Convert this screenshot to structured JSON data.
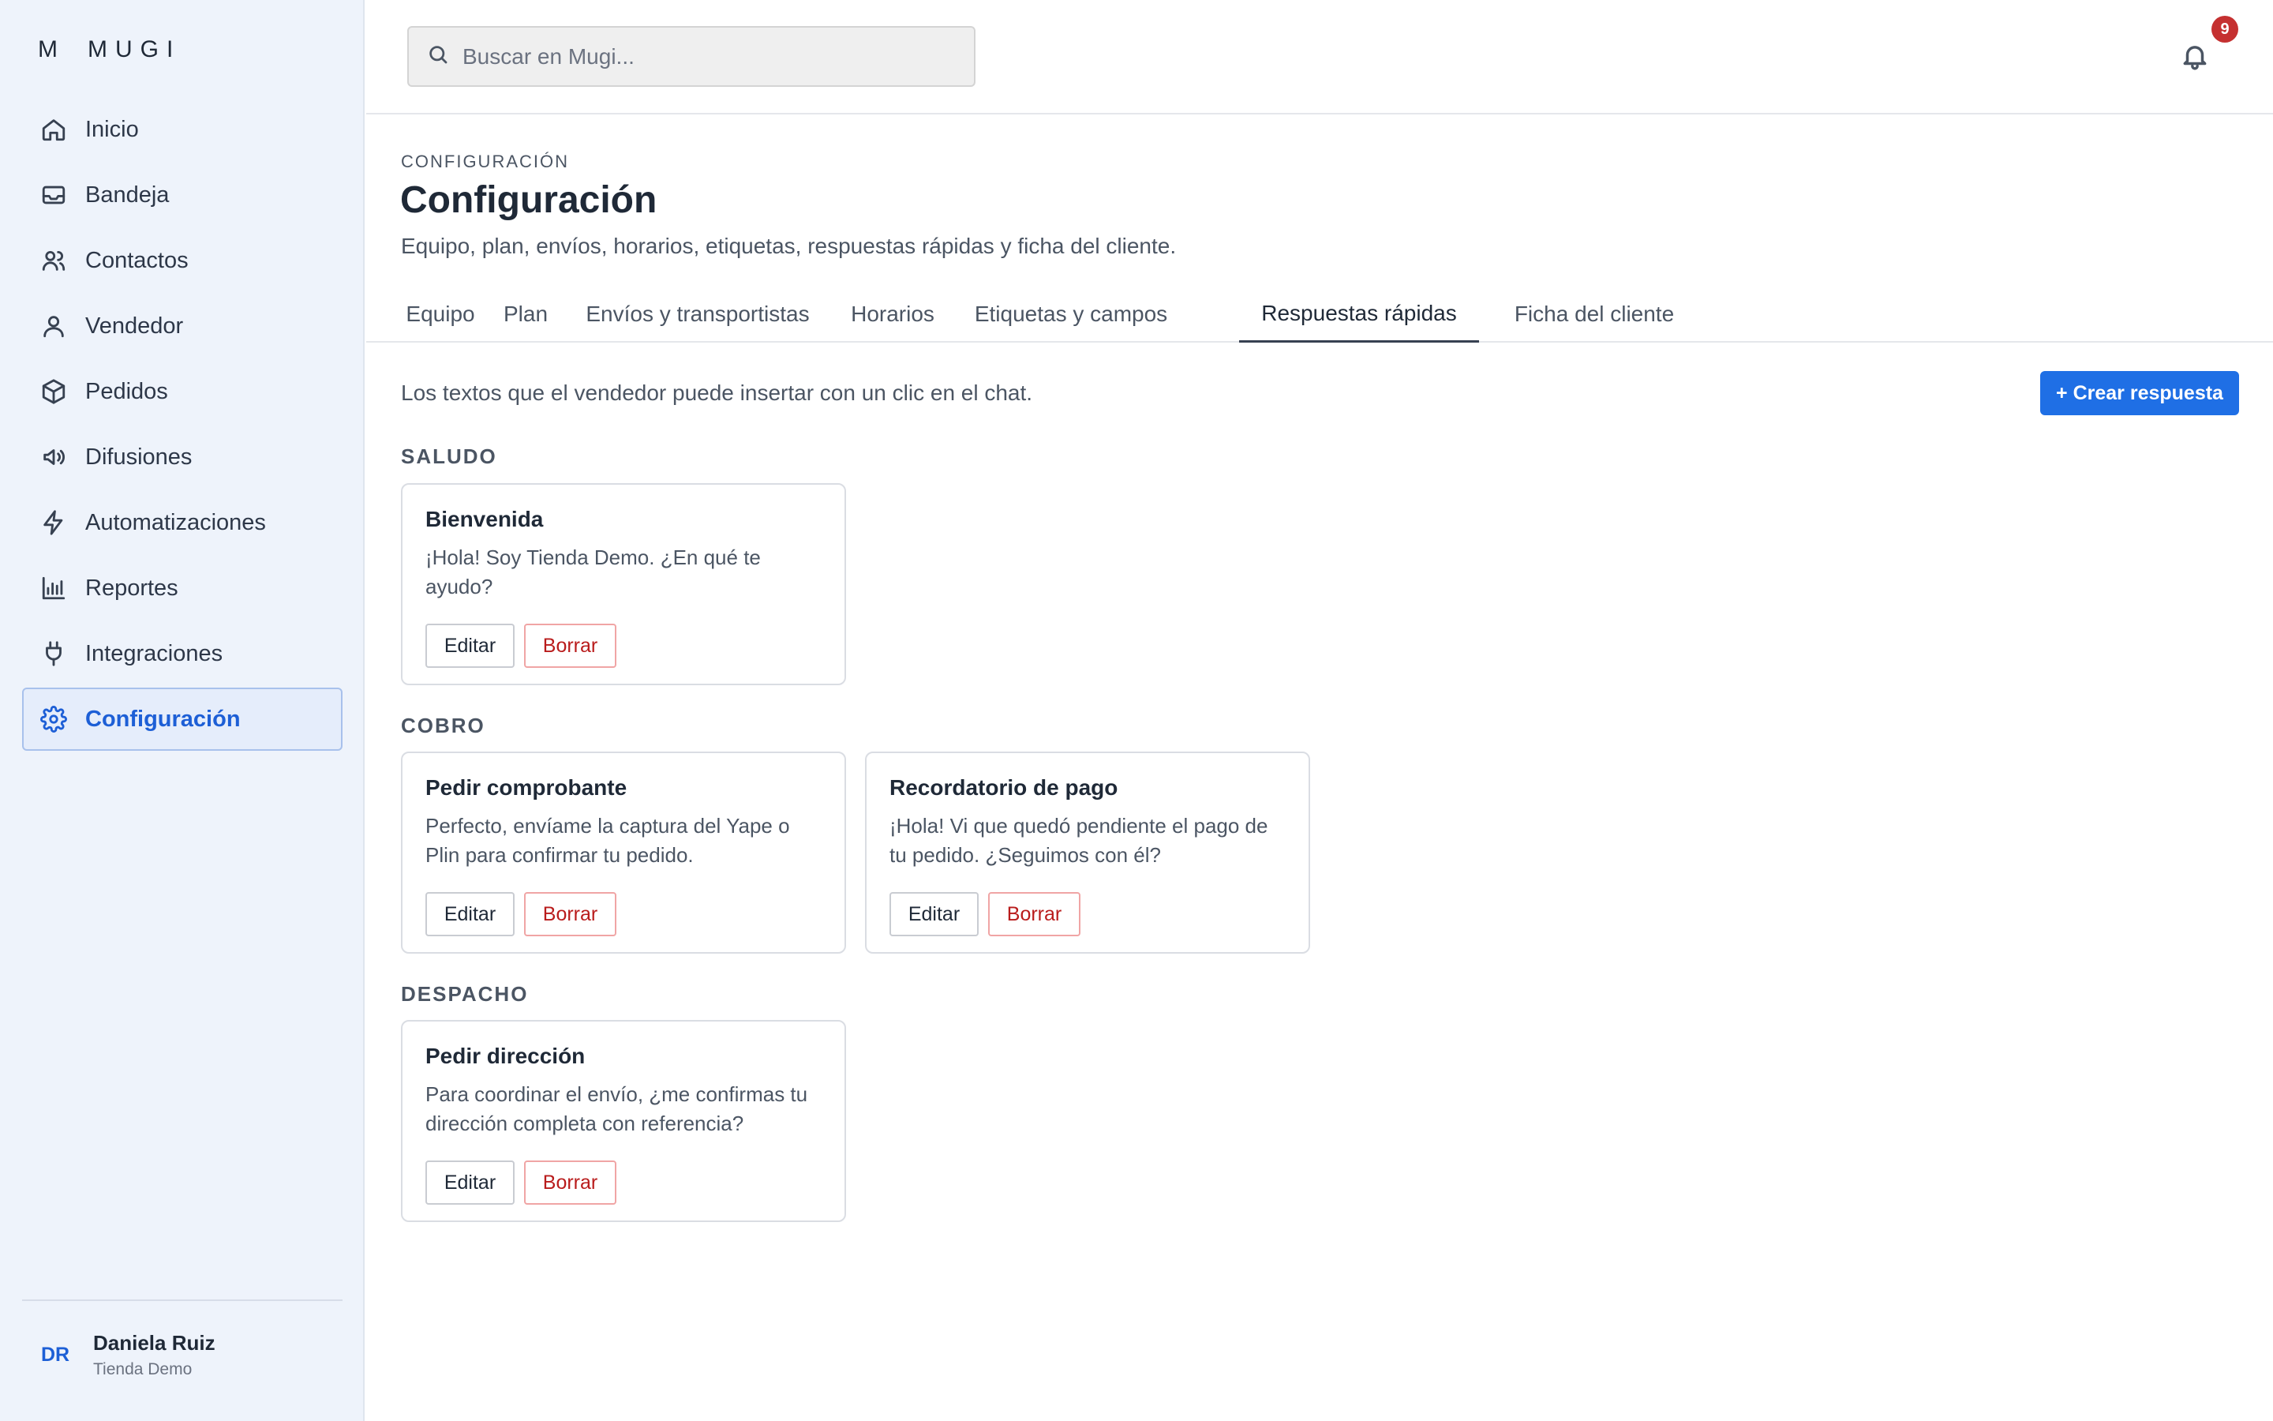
{
  "brand": {
    "mark": "M",
    "name": "MUGI"
  },
  "search": {
    "placeholder": "Buscar en Mugi..."
  },
  "notifications": {
    "count": "9"
  },
  "sidebar": {
    "items": [
      {
        "label": "Inicio",
        "icon": "home-icon"
      },
      {
        "label": "Bandeja",
        "icon": "inbox-icon"
      },
      {
        "label": "Contactos",
        "icon": "users-icon"
      },
      {
        "label": "Vendedor",
        "icon": "user-icon"
      },
      {
        "label": "Pedidos",
        "icon": "box-icon"
      },
      {
        "label": "Difusiones",
        "icon": "megaphone-icon"
      },
      {
        "label": "Automatizaciones",
        "icon": "bolt-icon"
      },
      {
        "label": "Reportes",
        "icon": "bar-chart-icon"
      },
      {
        "label": "Integraciones",
        "icon": "plug-icon"
      },
      {
        "label": "Configuración",
        "icon": "gear-icon",
        "active": true
      }
    ]
  },
  "user": {
    "initials": "DR",
    "name": "Daniela Ruiz",
    "store": "Tienda Demo"
  },
  "page": {
    "eyebrow": "CONFIGURACIÓN",
    "title": "Configuración",
    "description": "Equipo, plan, envíos, horarios, etiquetas, respuestas rápidas y ficha del cliente."
  },
  "tabs": [
    {
      "label": "Equipo"
    },
    {
      "label": "Plan"
    },
    {
      "label": "Envíos y transportistas"
    },
    {
      "label": "Horarios"
    },
    {
      "label": "Etiquetas y campos"
    },
    {
      "label": "Respuestas rápidas",
      "active": true
    },
    {
      "label": "Ficha del cliente"
    }
  ],
  "quick_replies": {
    "intro": "Los textos que el vendedor puede insertar con un clic en el chat.",
    "create_label": "+ Crear respuesta",
    "edit_label": "Editar",
    "delete_label": "Borrar",
    "groups": [
      {
        "label": "SALUDO",
        "cards": [
          {
            "title": "Bienvenida",
            "text": "¡Hola! Soy Tienda Demo. ¿En qué te ayudo?"
          }
        ]
      },
      {
        "label": "COBRO",
        "cards": [
          {
            "title": "Pedir comprobante",
            "text": "Perfecto, envíame la captura del Yape o Plin para confirmar tu pedido."
          },
          {
            "title": "Recordatorio de pago",
            "text": "¡Hola! Vi que quedó pendiente el pago de tu pedido. ¿Seguimos con él?"
          }
        ]
      },
      {
        "label": "DESPACHO",
        "cards": [
          {
            "title": "Pedir dirección",
            "text": "Para coordinar el envío, ¿me confirmas tu dirección completa con referencia?"
          }
        ]
      }
    ]
  },
  "colors": {
    "accent": "#1f6fe5",
    "sidebar_bg": "#eef3fb",
    "active_nav": "#1d5fd6",
    "danger": "#b91c1c",
    "badge": "#c53030"
  }
}
